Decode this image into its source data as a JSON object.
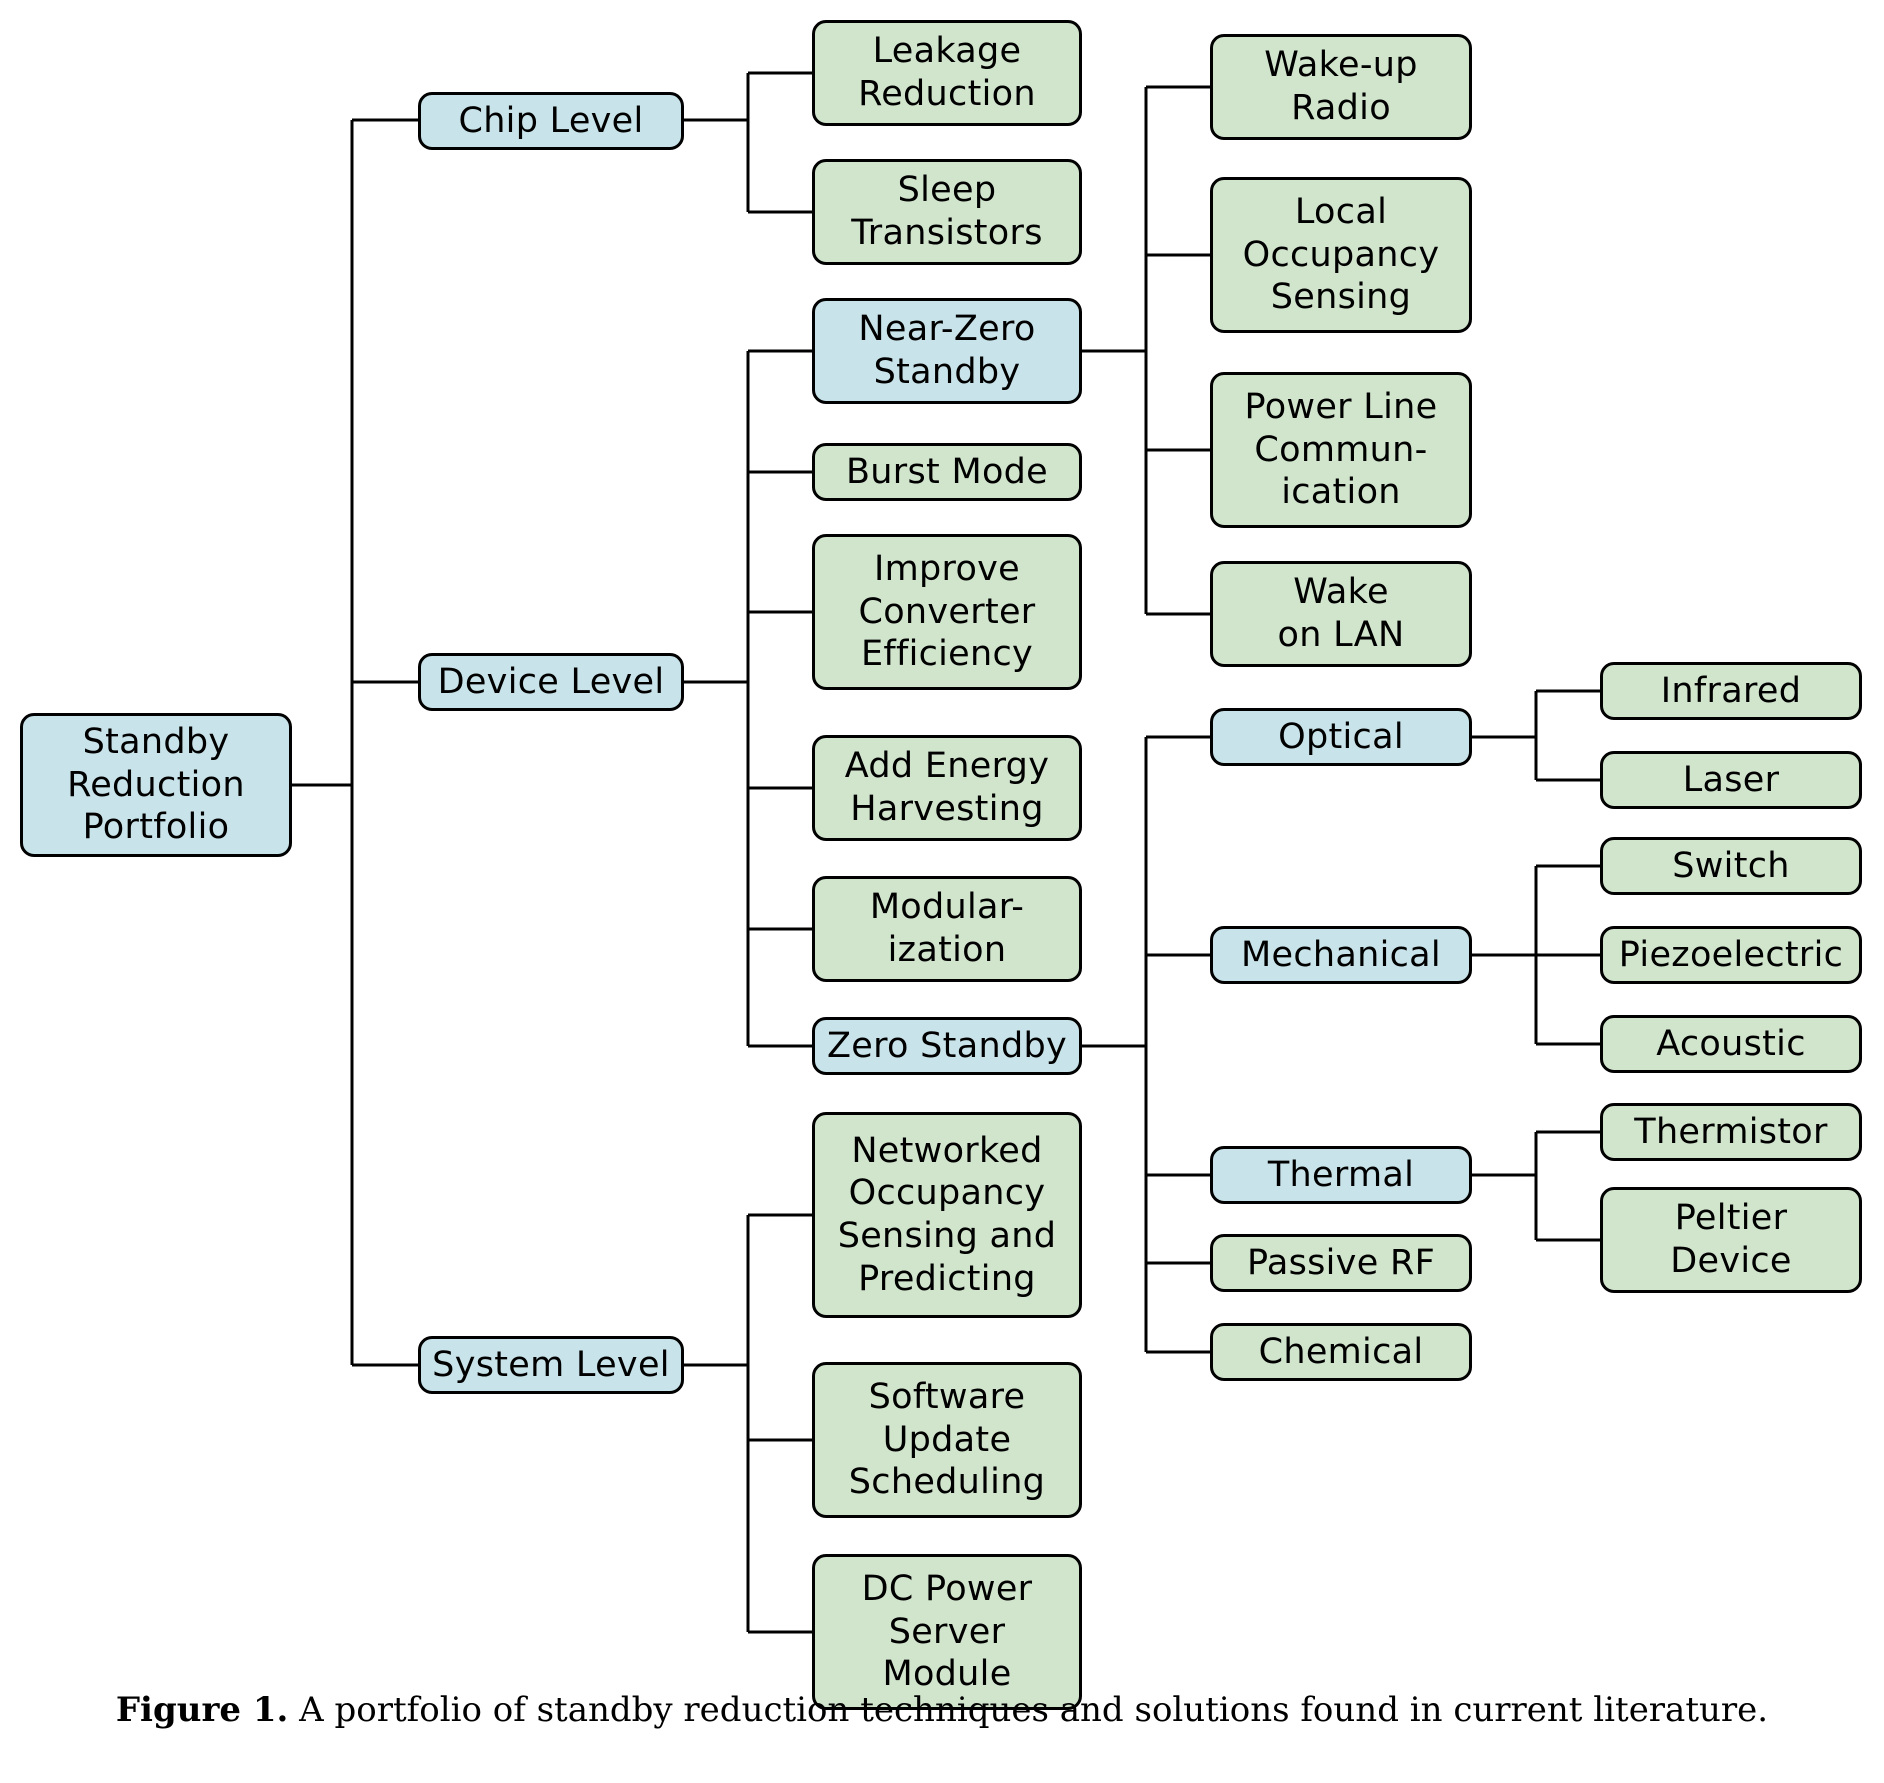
{
  "figure": {
    "caption_label": "Figure 1.",
    "caption_text": " A portfolio of standby reduction techniques and solutions found in current literature."
  },
  "colors": {
    "category_fill": "#c8e3e9",
    "leaf_fill": "#d1e5cd",
    "stroke": "#000000",
    "background": "#ffffff"
  },
  "nodes": {
    "root": "Standby\nReduction\nPortfolio",
    "chip_level": "Chip Level",
    "leakage_reduction": "Leakage\nReduction",
    "sleep_transistors": "Sleep\nTransistors",
    "device_level": "Device Level",
    "near_zero_standby": "Near-Zero\nStandby",
    "burst_mode": "Burst Mode",
    "improve_converter_efficiency": "Improve\nConverter\nEfficiency",
    "add_energy_harvesting": "Add Energy\nHarvesting",
    "modularization": "Modular-\nization",
    "zero_standby": "Zero Standby",
    "wake_up_radio": "Wake-up\nRadio",
    "local_occupancy_sensing": "Local\nOccupancy\nSensing",
    "power_line_communication": "Power Line\nCommun-\nication",
    "wake_on_lan": "Wake\non LAN",
    "optical": "Optical",
    "infrared": "Infrared",
    "laser": "Laser",
    "mechanical": "Mechanical",
    "switch": "Switch",
    "piezoelectric": "Piezoelectric",
    "acoustic": "Acoustic",
    "thermal": "Thermal",
    "thermistor": "Thermistor",
    "peltier_device": "Peltier\nDevice",
    "passive_rf": "Passive RF",
    "chemical": "Chemical",
    "system_level": "System Level",
    "networked_occupancy_sensing_and_predicting": "Networked\nOccupancy\nSensing and\nPredicting",
    "software_update_scheduling": "Software\nUpdate\nScheduling",
    "dc_power_server_module": "DC Power\nServer\nModule"
  },
  "chart_data": {
    "type": "tree",
    "title": "Standby Reduction Portfolio",
    "root": {
      "label": "Standby Reduction Portfolio",
      "kind": "category",
      "children": [
        {
          "label": "Chip Level",
          "kind": "category",
          "children": [
            {
              "label": "Leakage Reduction",
              "kind": "leaf"
            },
            {
              "label": "Sleep Transistors",
              "kind": "leaf"
            }
          ]
        },
        {
          "label": "Device Level",
          "kind": "category",
          "children": [
            {
              "label": "Near-Zero Standby",
              "kind": "category",
              "children": [
                {
                  "label": "Wake-up Radio",
                  "kind": "leaf"
                },
                {
                  "label": "Local Occupancy Sensing",
                  "kind": "leaf"
                },
                {
                  "label": "Power Line Communication",
                  "kind": "leaf"
                },
                {
                  "label": "Wake on LAN",
                  "kind": "leaf"
                }
              ]
            },
            {
              "label": "Burst Mode",
              "kind": "leaf"
            },
            {
              "label": "Improve Converter Efficiency",
              "kind": "leaf"
            },
            {
              "label": "Add Energy Harvesting",
              "kind": "leaf"
            },
            {
              "label": "Modularization",
              "kind": "leaf"
            },
            {
              "label": "Zero Standby",
              "kind": "category",
              "children": [
                {
                  "label": "Optical",
                  "kind": "category",
                  "children": [
                    {
                      "label": "Infrared",
                      "kind": "leaf"
                    },
                    {
                      "label": "Laser",
                      "kind": "leaf"
                    }
                  ]
                },
                {
                  "label": "Mechanical",
                  "kind": "category",
                  "children": [
                    {
                      "label": "Switch",
                      "kind": "leaf"
                    },
                    {
                      "label": "Piezoelectric",
                      "kind": "leaf"
                    },
                    {
                      "label": "Acoustic",
                      "kind": "leaf"
                    }
                  ]
                },
                {
                  "label": "Thermal",
                  "kind": "category",
                  "children": [
                    {
                      "label": "Thermistor",
                      "kind": "leaf"
                    },
                    {
                      "label": "Peltier Device",
                      "kind": "leaf"
                    }
                  ]
                },
                {
                  "label": "Passive RF",
                  "kind": "leaf"
                },
                {
                  "label": "Chemical",
                  "kind": "leaf"
                }
              ]
            }
          ]
        },
        {
          "label": "System Level",
          "kind": "category",
          "children": [
            {
              "label": "Networked Occupancy Sensing and Predicting",
              "kind": "leaf"
            },
            {
              "label": "Software Update Scheduling",
              "kind": "leaf"
            },
            {
              "label": "DC Power Server Module",
              "kind": "leaf"
            }
          ]
        }
      ]
    }
  }
}
